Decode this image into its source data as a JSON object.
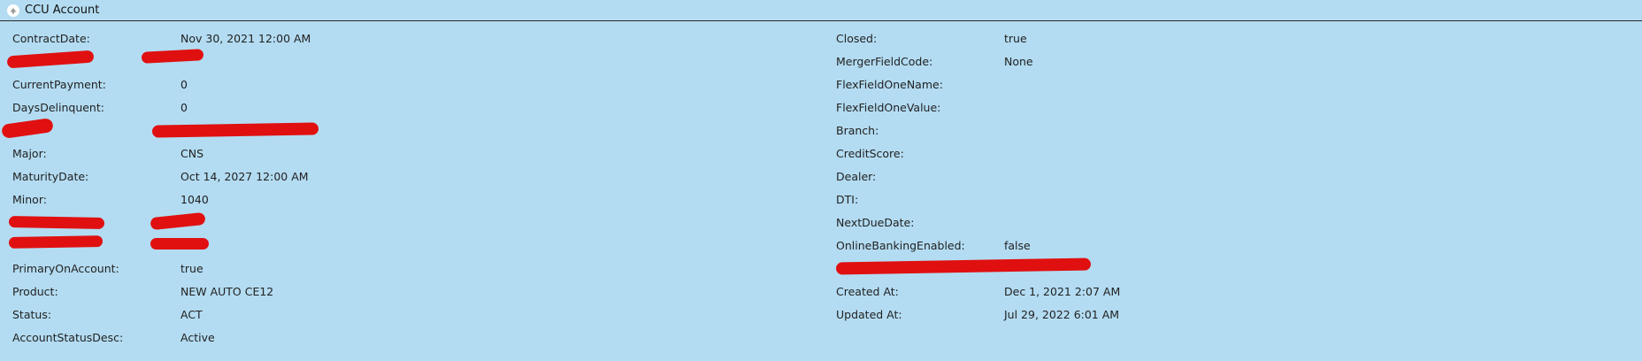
{
  "header": {
    "title": "CCU Account"
  },
  "left_fields": [
    {
      "label": "ContractDate:",
      "value": "Nov 30, 2021 12:00 AM"
    },
    {
      "label": "",
      "value": "",
      "redacted": true
    },
    {
      "label": "CurrentPayment:",
      "value": "0"
    },
    {
      "label": "DaysDelinquent:",
      "value": "0"
    },
    {
      "label": "",
      "value": "",
      "redacted": true
    },
    {
      "label": "Major:",
      "value": "CNS"
    },
    {
      "label": "MaturityDate:",
      "value": "Oct 14, 2027 12:00 AM"
    },
    {
      "label": "Minor:",
      "value": "1040"
    },
    {
      "label": "",
      "value": "",
      "redacted": true
    },
    {
      "label": "",
      "value": "",
      "redacted": true
    },
    {
      "label": "PrimaryOnAccount:",
      "value": "true"
    },
    {
      "label": "Product:",
      "value": "NEW AUTO CE12"
    },
    {
      "label": "Status:",
      "value": "ACT"
    },
    {
      "label": "AccountStatusDesc:",
      "value": "Active"
    }
  ],
  "right_fields": [
    {
      "label": "Closed:",
      "value": "true"
    },
    {
      "label": "MergerFieldCode:",
      "value": "None"
    },
    {
      "label": "FlexFieldOneName:",
      "value": ""
    },
    {
      "label": "FlexFieldOneValue:",
      "value": ""
    },
    {
      "label": "Branch:",
      "value": ""
    },
    {
      "label": "CreditScore:",
      "value": ""
    },
    {
      "label": "Dealer:",
      "value": ""
    },
    {
      "label": "DTI:",
      "value": ""
    },
    {
      "label": "NextDueDate:",
      "value": ""
    },
    {
      "label": "OnlineBankingEnabled:",
      "value": "false"
    },
    {
      "label": "",
      "value": "",
      "redacted": true
    },
    {
      "label": "Created At:",
      "value": "Dec 1, 2021 2:07 AM"
    },
    {
      "label": "Updated At:",
      "value": "Jul 29, 2022 6:01 AM"
    }
  ],
  "colors": {
    "panel": "#b3dcf2",
    "redaction": "#e01010"
  },
  "icons": {
    "toggle": "collapse-up-arrow-icon"
  }
}
